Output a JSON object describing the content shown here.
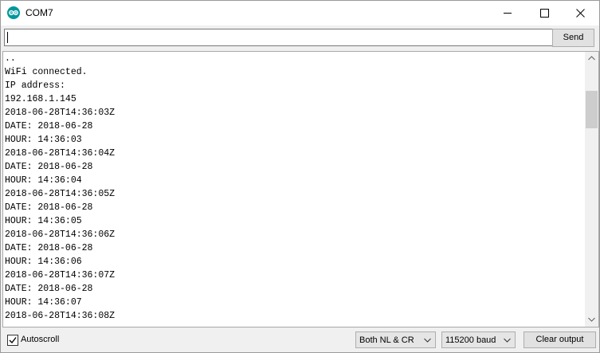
{
  "window": {
    "title": "COM7",
    "accent_color": "#00979c"
  },
  "input_row": {
    "value": "",
    "send_label": "Send"
  },
  "output": {
    "lines": [
      "..",
      "WiFi connected.",
      "IP address:",
      "192.168.1.145",
      "2018-06-28T14:36:03Z",
      "DATE: 2018-06-28",
      "HOUR: 14:36:03",
      "2018-06-28T14:36:04Z",
      "DATE: 2018-06-28",
      "HOUR: 14:36:04",
      "2018-06-28T14:36:05Z",
      "DATE: 2018-06-28",
      "HOUR: 14:36:05",
      "2018-06-28T14:36:06Z",
      "DATE: 2018-06-28",
      "HOUR: 14:36:06",
      "2018-06-28T14:36:07Z",
      "DATE: 2018-06-28",
      "HOUR: 14:36:07",
      "2018-06-28T14:36:08Z"
    ]
  },
  "bottom": {
    "autoscroll_label": "Autoscroll",
    "autoscroll_checked": true,
    "line_ending": "Both NL & CR",
    "baud_rate": "115200 baud",
    "clear_label": "Clear output"
  }
}
